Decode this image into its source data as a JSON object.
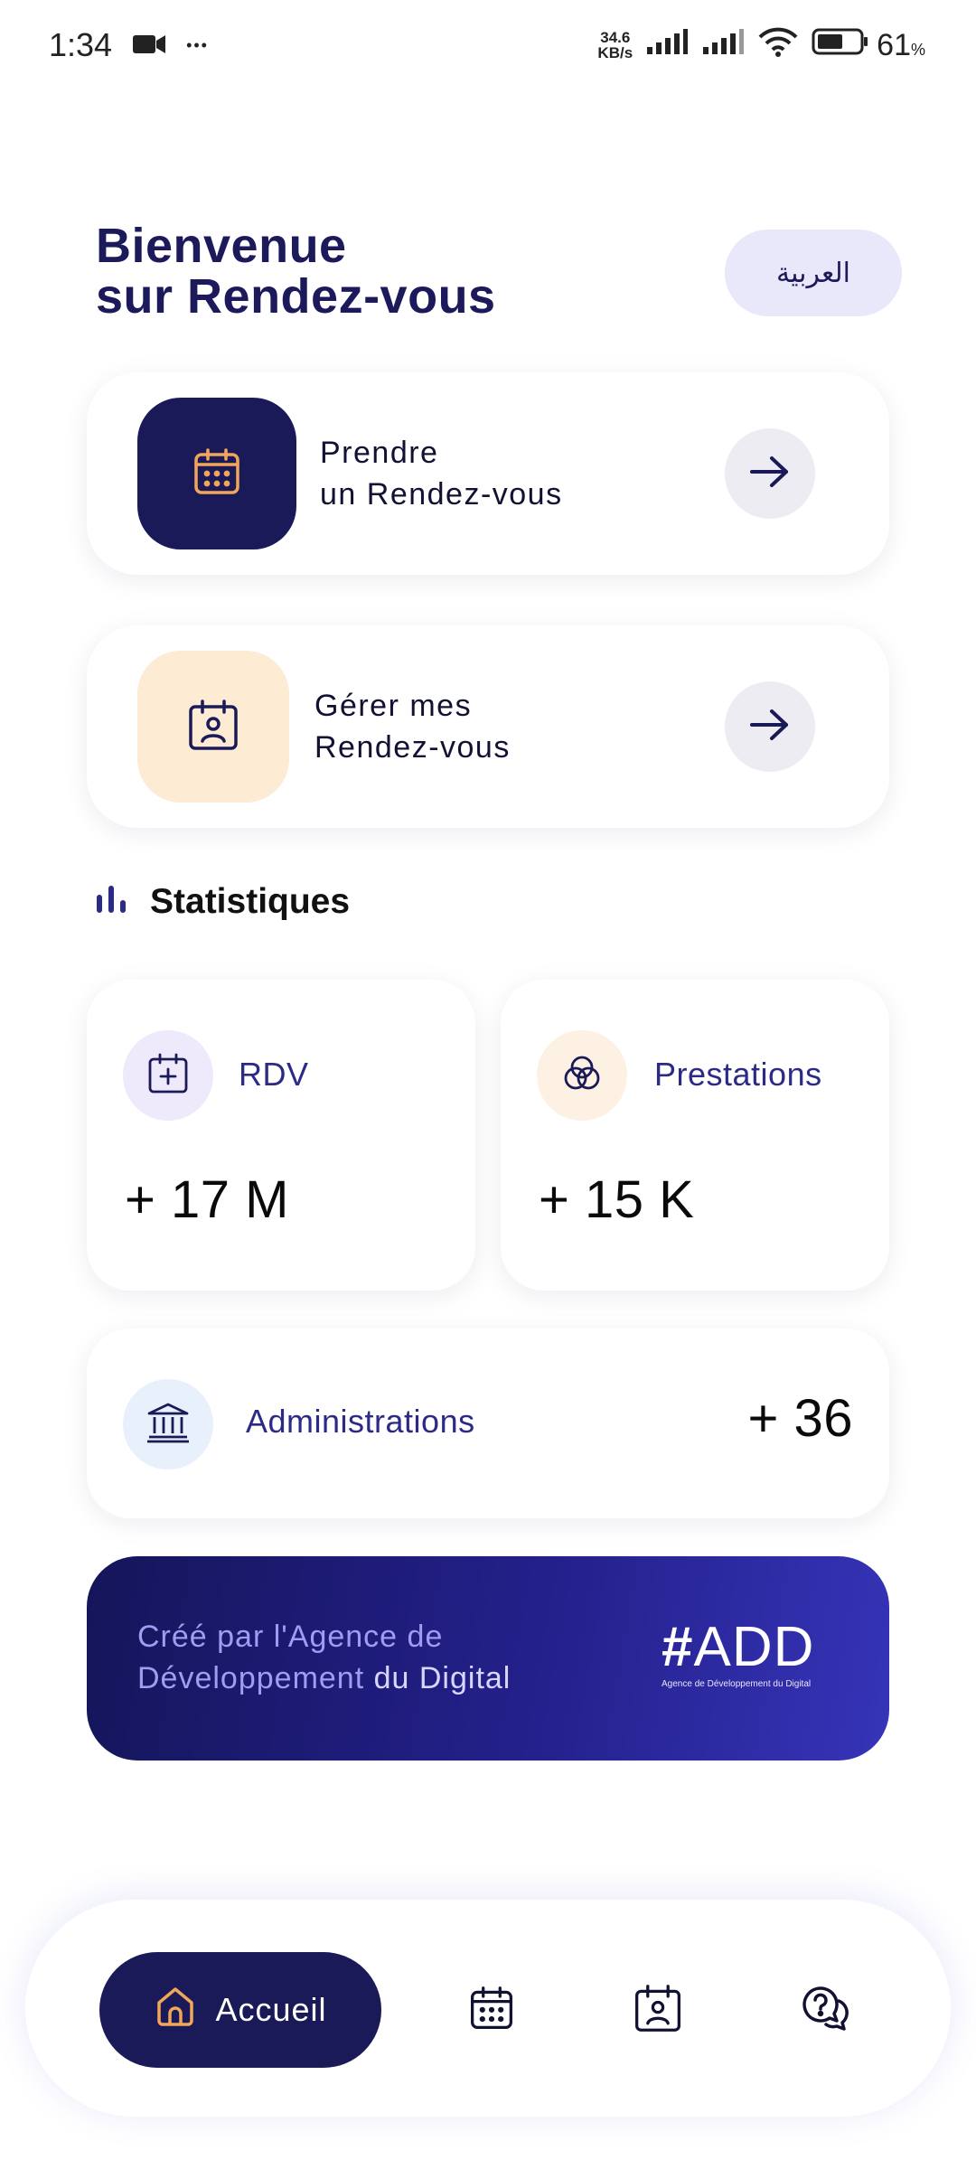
{
  "status_bar": {
    "time": "1:34",
    "more": "•••",
    "net_speed_value": "34.6",
    "net_speed_unit": "KB/s",
    "battery_percent": "61",
    "battery_unit": "%",
    "battery_level": 0.61
  },
  "header": {
    "welcome_line1": "Bienvenue",
    "welcome_line2": "sur Rendez-vous",
    "language_button": "العربية"
  },
  "actions": [
    {
      "label": "Prendre\nun Rendez-vous",
      "icon": "calendar-icon"
    },
    {
      "label": "Gérer mes\nRendez-vous",
      "icon": "calendar-person-icon"
    }
  ],
  "stats": {
    "title": "Statistiques",
    "rdv": {
      "label": "RDV",
      "value": "+ 17 M",
      "icon": "calendar-plus-icon"
    },
    "prestations": {
      "label": "Prestations",
      "value": "+ 15 K",
      "icon": "circles-icon"
    },
    "administrations": {
      "label": "Administrations",
      "value": "+ 36",
      "icon": "bank-icon"
    }
  },
  "banner": {
    "line1": "Créé par l'Agence de",
    "line2_a": "Développement",
    "line2_b": " du Digital",
    "logo_hash": "#",
    "logo_text": "ADD",
    "logo_caption": "Agence de Développement du Digital"
  },
  "bottom_nav": {
    "home_label": "Accueil",
    "items": [
      "home-icon",
      "calendar-icon",
      "calendar-person-icon",
      "help-chat-icon"
    ]
  },
  "colors": {
    "primary": "#1b1a58",
    "accent_orange": "#f2a65a",
    "peach": "#fdebd3",
    "lavender": "#e9e8fb"
  }
}
